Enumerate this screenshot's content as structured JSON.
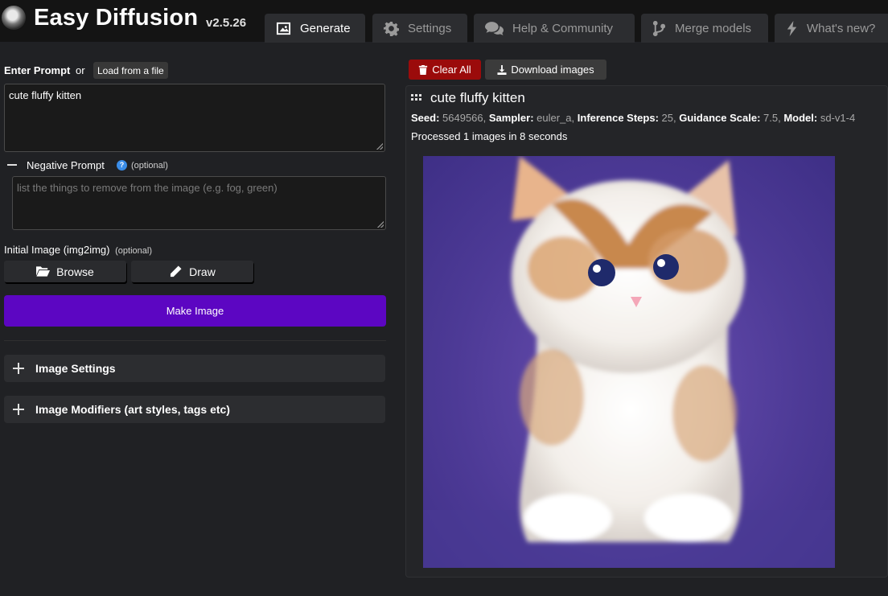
{
  "header": {
    "title": "Easy Diffusion",
    "version": "v2.5.26",
    "tabs": [
      {
        "label": "Generate",
        "icon": "image-icon"
      },
      {
        "label": "Settings",
        "icon": "gear-icon"
      },
      {
        "label": "Help & Community",
        "icon": "comments-icon"
      },
      {
        "label": "Merge models",
        "icon": "code-branch-icon"
      },
      {
        "label": "What's new?",
        "icon": "bolt-icon"
      }
    ]
  },
  "prompt": {
    "label": "Enter Prompt",
    "or_text": "or",
    "load_button": "Load from a file",
    "value": "cute fluffy kitten"
  },
  "negative_prompt": {
    "label": "Negative Prompt",
    "optional": "(optional)",
    "placeholder": "list the things to remove from the image (e.g. fog, green)"
  },
  "init_image": {
    "label": "Initial Image (img2img)",
    "optional": "(optional)",
    "browse_label": "Browse",
    "draw_label": "Draw"
  },
  "make_image_label": "Make Image",
  "sections": {
    "image_settings": "Image Settings",
    "image_modifiers": "Image Modifiers (art styles, tags etc)"
  },
  "results": {
    "clear_all": "Clear All",
    "download_images": "Download images",
    "title": "cute fluffy kitten",
    "seed_label": "Seed:",
    "seed": "5649566,",
    "sampler_label": "Sampler:",
    "sampler": "euler_a,",
    "steps_label": "Inference Steps:",
    "steps": "25,",
    "guidance_label": "Guidance Scale:",
    "guidance": "7.5,",
    "model_label": "Model:",
    "model": "sd-v1-4",
    "processed": "Processed 1 images in 8 seconds"
  },
  "colors": {
    "make_button": "#5c06c2",
    "clear_button": "#9b0b0b",
    "help_icon": "#3a8de8"
  }
}
